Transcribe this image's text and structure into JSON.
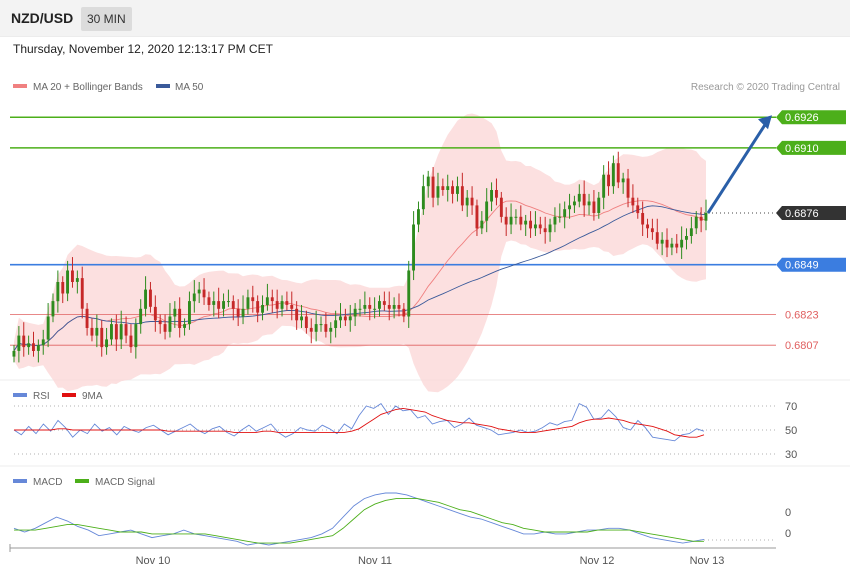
{
  "header": {
    "pair": "NZD/USD",
    "timeframe": "30 MIN",
    "datetime": "Thursday, November 12, 2020 12:13:17 PM CET"
  },
  "legend": {
    "ma20": "MA 20 + Bollinger Bands",
    "ma50": "MA 50",
    "rsi": "RSI",
    "rsi_ma": "9MA",
    "macd": "MACD",
    "macd_signal": "MACD Signal"
  },
  "credit": "Research © 2020 Trading Central",
  "colors": {
    "up": "#2e8b1e",
    "down": "#c62828",
    "band": "#fbd5d5",
    "ma20": "#f08080",
    "ma50": "#3a5a9a",
    "resistance": "#4caf1a",
    "support": "#3b7de0",
    "minor": "#e06060",
    "arrow": "#2a5fa8",
    "rsi": "#6688d8",
    "rsi_ma": "#e01010",
    "macd": "#6688d8",
    "macd_signal": "#4caf1a"
  },
  "chart_data": [
    {
      "type": "candlestick",
      "title": "NZD/USD 30 MIN",
      "ylim": [
        0.6793,
        0.6935
      ],
      "x_ticks": [
        "Nov 10",
        "Nov 11",
        "Nov 12",
        "Nov 13"
      ],
      "levels": [
        {
          "value": 0.6926,
          "label": "0.6926",
          "kind": "resistance"
        },
        {
          "value": 0.691,
          "label": "0.6910",
          "kind": "resistance"
        },
        {
          "value": 0.6876,
          "label": "0.6876",
          "kind": "last"
        },
        {
          "value": 0.6849,
          "label": "0.6849",
          "kind": "support"
        },
        {
          "value": 0.6823,
          "label": "0.6823",
          "kind": "minor"
        },
        {
          "value": 0.6807,
          "label": "0.6807",
          "kind": "minor"
        }
      ],
      "forecast_arrow": {
        "from": 0.6876,
        "to": 0.6926
      },
      "closes": [
        0.6804,
        0.6812,
        0.6806,
        0.6808,
        0.6804,
        0.6807,
        0.681,
        0.6822,
        0.683,
        0.684,
        0.6834,
        0.6846,
        0.684,
        0.6842,
        0.6826,
        0.6816,
        0.6812,
        0.6816,
        0.6806,
        0.681,
        0.6818,
        0.681,
        0.6818,
        0.6812,
        0.6806,
        0.6818,
        0.6826,
        0.6836,
        0.6827,
        0.682,
        0.6818,
        0.6814,
        0.6822,
        0.6826,
        0.6816,
        0.6818,
        0.683,
        0.6834,
        0.6836,
        0.6832,
        0.6828,
        0.683,
        0.6826,
        0.683,
        0.683,
        0.6826,
        0.6822,
        0.6826,
        0.6832,
        0.683,
        0.6824,
        0.6828,
        0.6832,
        0.683,
        0.6826,
        0.683,
        0.6828,
        0.6826,
        0.682,
        0.6822,
        0.6816,
        0.6814,
        0.6818,
        0.6818,
        0.6814,
        0.6816,
        0.682,
        0.6822,
        0.682,
        0.6822,
        0.6826,
        0.6826,
        0.6828,
        0.6826,
        0.6826,
        0.683,
        0.6828,
        0.6826,
        0.6828,
        0.6826,
        0.6822,
        0.6846,
        0.687,
        0.6878,
        0.689,
        0.6895,
        0.6884,
        0.689,
        0.6888,
        0.689,
        0.6886,
        0.689,
        0.688,
        0.6884,
        0.688,
        0.6868,
        0.6872,
        0.6882,
        0.6888,
        0.6884,
        0.6874,
        0.687,
        0.6874,
        0.6874,
        0.687,
        0.6872,
        0.6868,
        0.687,
        0.6868,
        0.6866,
        0.687,
        0.6874,
        0.6874,
        0.6878,
        0.688,
        0.6882,
        0.6886,
        0.688,
        0.6882,
        0.6876,
        0.6884,
        0.6896,
        0.689,
        0.6902,
        0.6892,
        0.6894,
        0.6884,
        0.688,
        0.6876,
        0.687,
        0.6868,
        0.6866,
        0.686,
        0.6862,
        0.6858,
        0.686,
        0.6858,
        0.6862,
        0.6864,
        0.6868,
        0.6874,
        0.6872,
        0.6876
      ]
    },
    {
      "type": "line",
      "title": "RSI",
      "ylim": [
        25,
        75
      ],
      "yticks": [
        70,
        50,
        30
      ],
      "series": [
        {
          "name": "RSI",
          "values": [
            50,
            46,
            53,
            47,
            55,
            49,
            58,
            52,
            44,
            50,
            47,
            55,
            49,
            52,
            46,
            53,
            50,
            48,
            52,
            54,
            50,
            46,
            49,
            52,
            55,
            50,
            47,
            51,
            53,
            48,
            45,
            50,
            54,
            49,
            52,
            55,
            48,
            44,
            47,
            52,
            50,
            49,
            54,
            51,
            47,
            55,
            51,
            62,
            70,
            68,
            72,
            63,
            70,
            66,
            67,
            60,
            62,
            55,
            57,
            58,
            52,
            55,
            60,
            54,
            52,
            50,
            46,
            47,
            48,
            50,
            48,
            49,
            52,
            56,
            54,
            57,
            58,
            72,
            69,
            59,
            60,
            67,
            61,
            52,
            50,
            58,
            52,
            44,
            43,
            42,
            41,
            46,
            47,
            51,
            49
          ]
        },
        {
          "name": "9MA",
          "values": [
            50,
            50,
            50,
            50,
            50,
            50,
            51,
            51,
            50,
            50,
            50,
            50,
            50,
            50,
            50,
            50,
            50,
            50,
            50,
            50,
            50,
            49,
            49,
            49,
            49,
            49,
            49,
            49,
            49,
            49,
            48,
            48,
            48,
            48,
            49,
            49,
            48,
            48,
            48,
            48,
            48,
            48,
            48,
            48,
            48,
            48,
            49,
            51,
            55,
            59,
            63,
            65,
            67,
            68,
            67,
            66,
            65,
            62,
            60,
            58,
            57,
            56,
            56,
            55,
            54,
            53,
            51,
            50,
            49,
            48,
            48,
            48,
            49,
            50,
            51,
            52,
            53,
            56,
            58,
            59,
            59,
            60,
            59,
            58,
            56,
            55,
            54,
            53,
            51,
            49,
            46,
            45,
            44,
            44,
            46
          ]
        }
      ]
    },
    {
      "type": "line",
      "title": "MACD",
      "yticks": [
        0,
        0
      ],
      "series": [
        {
          "name": "MACD",
          "values": [
            0.0002,
            0.0,
            0.0002,
            0.0005,
            0.0008,
            0.0006,
            0.0003,
            0.0001,
            -0.0002,
            -0.0001,
            0.0,
            0.0001,
            -0.0001,
            -0.0003,
            -0.0002,
            -0.0001,
            0.0001,
            -0.0001,
            -0.0002,
            -0.0003,
            -0.0004,
            -0.0005,
            -0.0007,
            -0.0006,
            -0.0007,
            -0.0006,
            -0.0005,
            -0.0004,
            -0.0003,
            -0.0001,
            0.0002,
            0.0008,
            0.0014,
            0.0018,
            0.002,
            0.0021,
            0.0021,
            0.002,
            0.0018,
            0.0016,
            0.0014,
            0.0012,
            0.001,
            0.0008,
            0.0007,
            0.0005,
            0.0003,
            0.0001,
            -0.0001,
            -0.0001,
            0.0,
            -0.0001,
            -0.0001,
            0.0,
            0.0001,
            0.0001,
            0.0002,
            0.0002,
            0.0001,
            -0.0001,
            -0.0003,
            -0.0004,
            -0.0005,
            -0.0006,
            -0.0005,
            -0.0004
          ]
        },
        {
          "name": "MACD Signal",
          "values": [
            0.0001,
            0.0001,
            0.0001,
            0.0002,
            0.0003,
            0.0004,
            0.0004,
            0.0003,
            0.0002,
            0.0001,
            0.0,
            0.0,
            0.0,
            -0.0001,
            -0.0001,
            -0.0001,
            -0.0001,
            -0.0001,
            -0.0001,
            -0.0002,
            -0.0003,
            -0.0004,
            -0.0005,
            -0.0006,
            -0.0006,
            -0.0006,
            -0.0006,
            -0.0005,
            -0.0004,
            -0.0003,
            -0.0002,
            0.0002,
            0.0007,
            0.0012,
            0.0015,
            0.0017,
            0.0018,
            0.0018,
            0.0018,
            0.0017,
            0.0016,
            0.0014,
            0.0012,
            0.0011,
            0.0009,
            0.0007,
            0.0005,
            0.0004,
            0.0002,
            0.0001,
            0.0,
            0.0,
            0.0,
            0.0,
            0.0,
            0.0001,
            0.0001,
            0.0001,
            0.0001,
            0.0,
            -0.0001,
            -0.0002,
            -0.0003,
            -0.0004,
            -0.0005,
            -0.0005
          ]
        }
      ]
    }
  ]
}
